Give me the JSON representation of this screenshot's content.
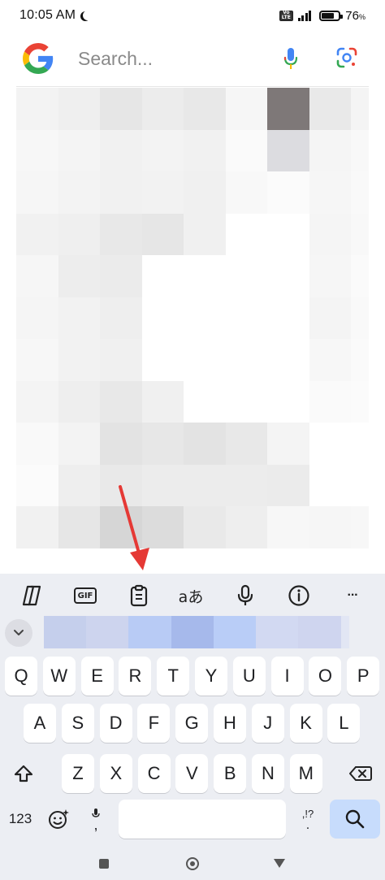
{
  "status_bar": {
    "time": "10:05 AM",
    "volte_top": "Vo",
    "volte_bottom": "LTE",
    "battery_percent": "76",
    "battery_unit": "%",
    "battery_level": 0.76
  },
  "search": {
    "placeholder": "Search...",
    "mic_icon": "mic-icon",
    "lens_icon": "google-lens-icon",
    "logo_icon": "google-g-logo"
  },
  "colors": {
    "accent_red": "#e53935",
    "search_key": "#c7dcfc",
    "keyboard_bg": "#eceef3"
  },
  "keyboard": {
    "toolbar": [
      "copilot-icon",
      "gif-icon",
      "clipboard-icon",
      "translate-icon",
      "mic-icon",
      "info-icon",
      "more-icon"
    ],
    "toolbar_gif_label": "GIF",
    "toolbar_translate_label": "aあ",
    "toolbar_more_label": "···",
    "row1": [
      "Q",
      "W",
      "E",
      "R",
      "T",
      "Y",
      "U",
      "I",
      "O",
      "P"
    ],
    "row2": [
      "A",
      "S",
      "D",
      "F",
      "G",
      "H",
      "J",
      "K",
      "L"
    ],
    "row3": [
      "Z",
      "X",
      "C",
      "V",
      "B",
      "N",
      "M"
    ],
    "numbers_label": "123",
    "comma_label": ",",
    "punct_top": ",!?",
    "punct_bottom": "."
  }
}
